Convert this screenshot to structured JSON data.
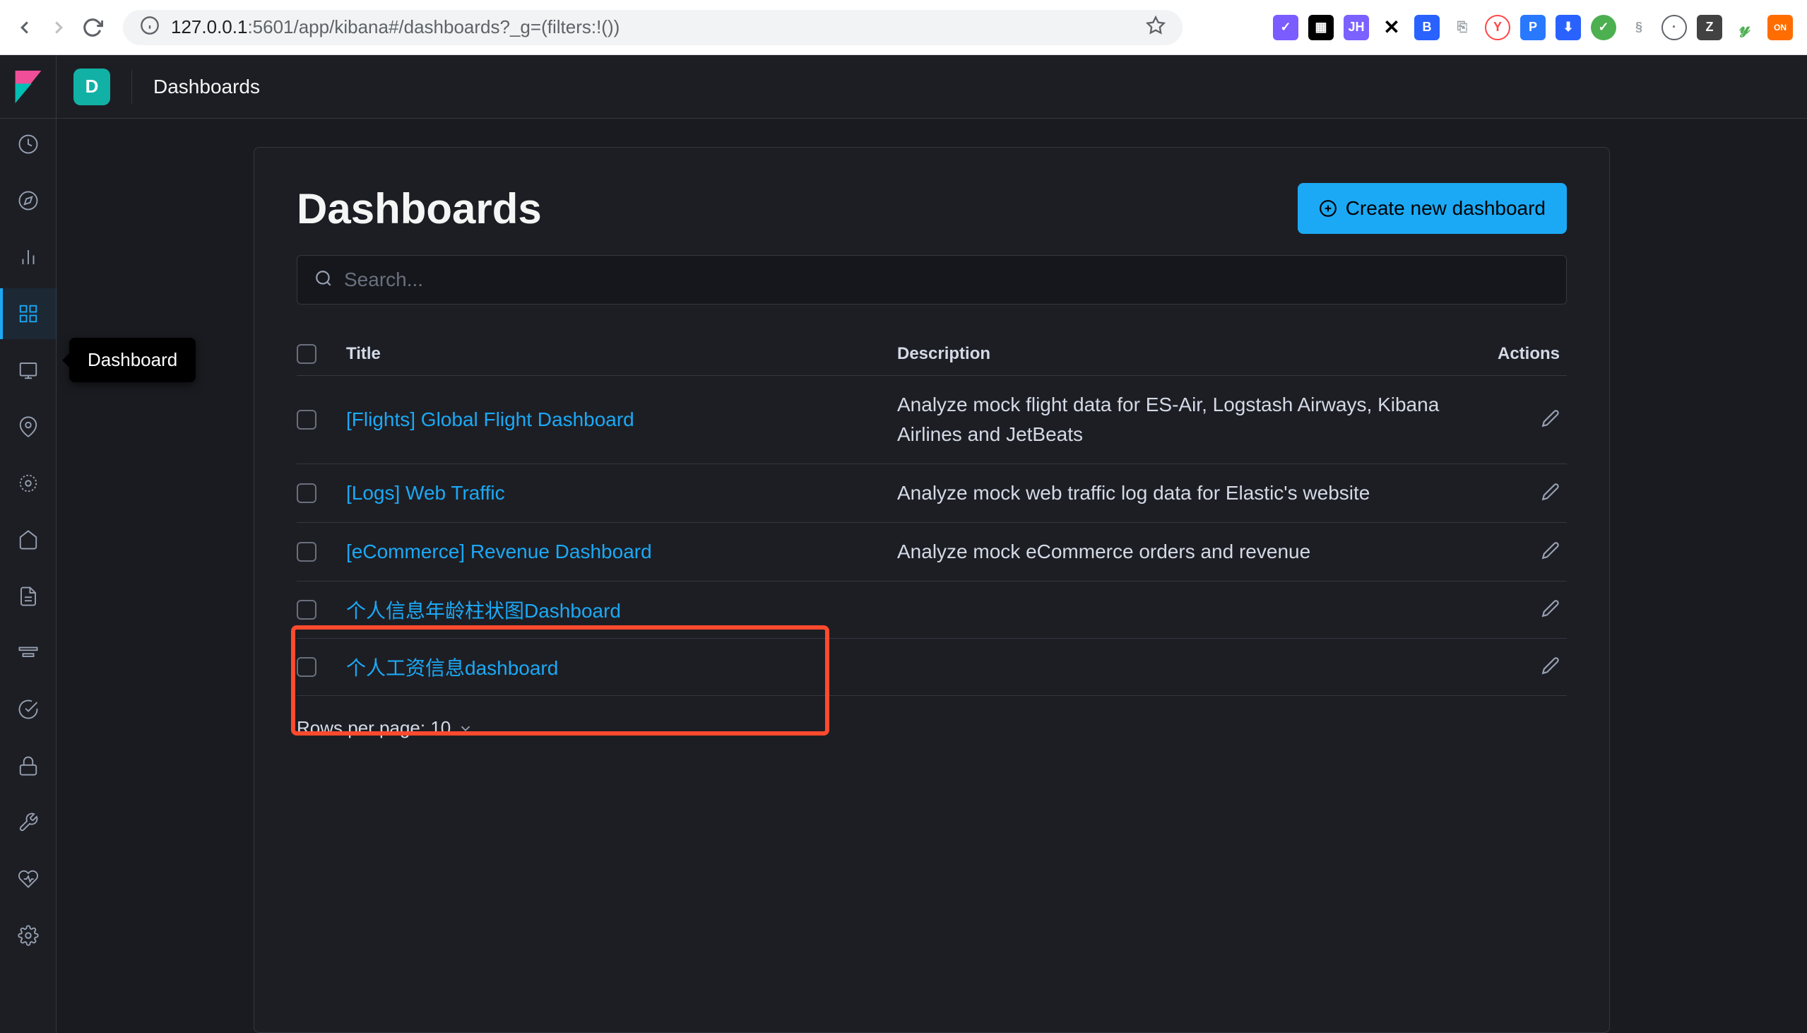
{
  "browser": {
    "url_prefix": "127.0.0.1",
    "url_suffix": ":5601/app/kibana#/dashboards?_g=(filters:!())"
  },
  "header": {
    "space_letter": "D",
    "breadcrumb": "Dashboards"
  },
  "sidebar": {
    "tooltip": "Dashboard"
  },
  "page": {
    "title": "Dashboards",
    "create_button": "Create new dashboard",
    "search_placeholder": "Search..."
  },
  "table": {
    "headers": {
      "title": "Title",
      "description": "Description",
      "actions": "Actions"
    },
    "rows": [
      {
        "title": "[Flights] Global Flight Dashboard",
        "description": "Analyze mock flight data for ES-Air, Logstash Airways, Kibana Airlines and JetBeats"
      },
      {
        "title": "[Logs] Web Traffic",
        "description": "Analyze mock web traffic log data for Elastic's website"
      },
      {
        "title": "[eCommerce] Revenue Dashboard",
        "description": "Analyze mock eCommerce orders and revenue"
      },
      {
        "title": "个人信息年龄柱状图Dashboard",
        "description": ""
      },
      {
        "title": "个人工资信息dashboard",
        "description": ""
      }
    ]
  },
  "pagination": {
    "label": "Rows per page: 10"
  }
}
